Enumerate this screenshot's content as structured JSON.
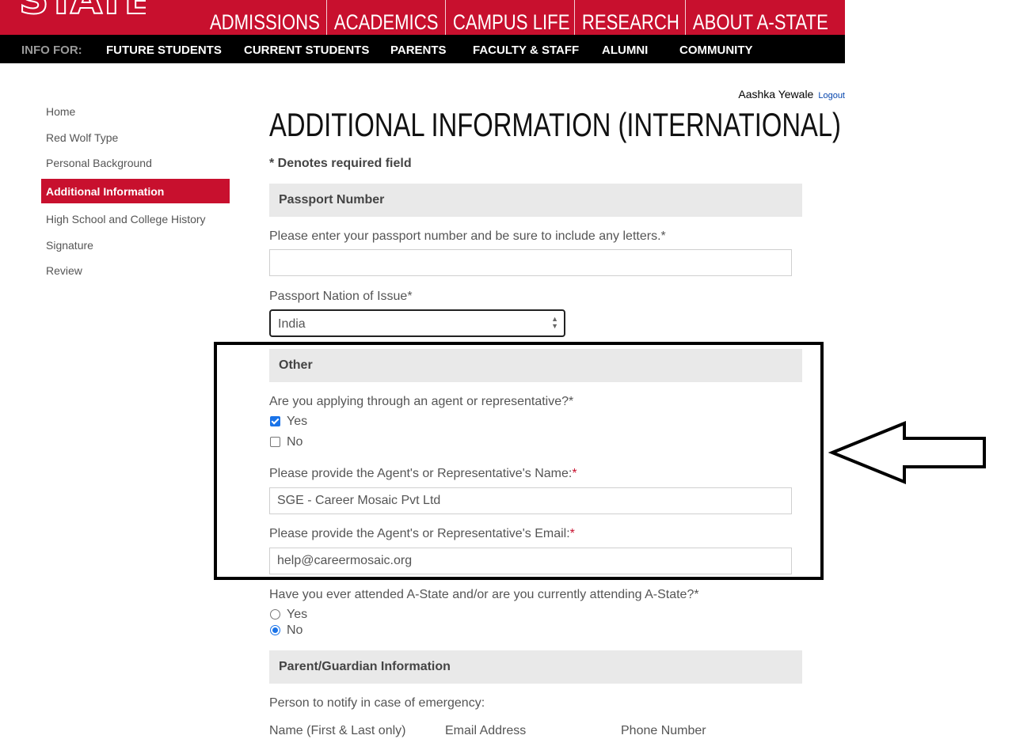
{
  "header": {
    "logo_text": "STATE",
    "nav": [
      "ADMISSIONS",
      "ACADEMICS",
      "CAMPUS LIFE",
      "RESEARCH",
      "ABOUT A-STATE"
    ],
    "info_label": "INFO FOR:",
    "info_links": [
      "FUTURE STUDENTS",
      "CURRENT STUDENTS",
      "PARENTS",
      "FACULTY & STAFF",
      "ALUMNI",
      "COMMUNITY"
    ],
    "accent_color": "#c8102e"
  },
  "user": {
    "name": "Aashka Yewale",
    "logout": "Logout"
  },
  "sidebar": {
    "items": [
      "Home",
      "Red Wolf Type",
      "Personal Background",
      "Additional Information",
      "High School and College History",
      "Signature",
      "Review"
    ],
    "active": "Additional Information"
  },
  "page": {
    "title": "ADDITIONAL INFORMATION (INTERNATIONAL)",
    "required_note": "* Denotes required field"
  },
  "passport": {
    "section": "Passport Number",
    "number_label": "Please enter your passport number and be sure to include any letters.*",
    "number_value": "",
    "nation_label": "Passport Nation of Issue*",
    "nation_value": "India"
  },
  "other": {
    "section": "Other",
    "agent_question": "Are you applying through an agent or representative?*",
    "agent_options": [
      "Yes",
      "No"
    ],
    "agent_selected": "Yes",
    "agent_name_label": "Please provide the Agent's or Representative's Name:",
    "agent_name_value": "SGE - Career Mosaic Pvt Ltd",
    "agent_email_label": "Please provide the Agent's or Representative's Email:",
    "agent_email_value": "help@careermosaic.org",
    "required_star": "*",
    "attended_question": "Have you ever attended A-State and/or are you currently attending A-State?*",
    "attended_options": [
      "Yes",
      "No"
    ],
    "attended_selected": "No"
  },
  "parent": {
    "section": "Parent/Guardian Information",
    "notify_label": "Person to notify in case of emergency:",
    "columns": [
      "Name (First & Last only)",
      "Email Address",
      "Phone Number"
    ]
  }
}
